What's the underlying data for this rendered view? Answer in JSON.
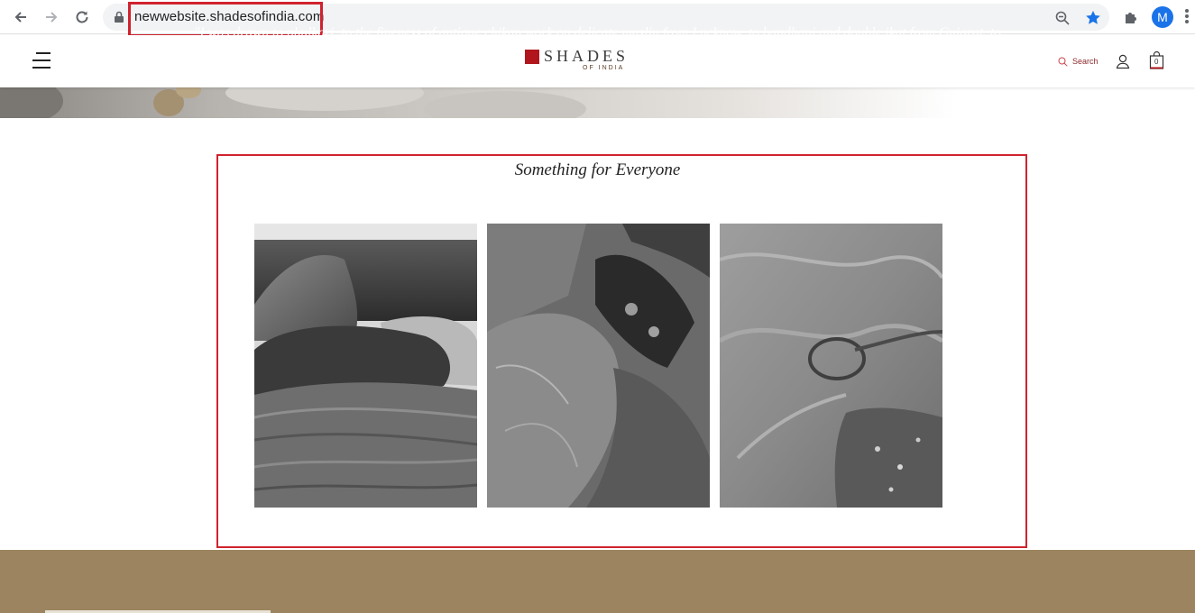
{
  "browser": {
    "url": "newwebsite.shadesofindia.com",
    "profile_initial": "M",
    "icons": [
      "back-icon",
      "forward-icon",
      "reload-icon",
      "lock-icon",
      "zoom-icon",
      "bookmark-star-icon",
      "extensions-icon",
      "more-icon"
    ],
    "colors": {
      "highlight": "#d0222e",
      "accent": "#1a73e8"
    }
  },
  "header": {
    "logo_main": "SHADES",
    "logo_sub": "OF INDIA",
    "search_label": "Search",
    "cart_count": "0",
    "colors": {
      "brand_red": "#b1161d"
    }
  },
  "section": {
    "title": "Something for Everyone",
    "cards": [
      {
        "name": "cushions-image"
      },
      {
        "name": "embroidered-fabric-image"
      },
      {
        "name": "sheer-fabric-image"
      }
    ]
  },
  "quote": {
    "text": "\"I was drawn to phulkari, to the fineness of antique chikan work on delicate muslin from Lucknow, to bandhani and double ikat from Gujarat, to Kantha embroidery....The wealth of this legacy inspires all we do at Shades of India.\"",
    "background": "#9b845f"
  }
}
